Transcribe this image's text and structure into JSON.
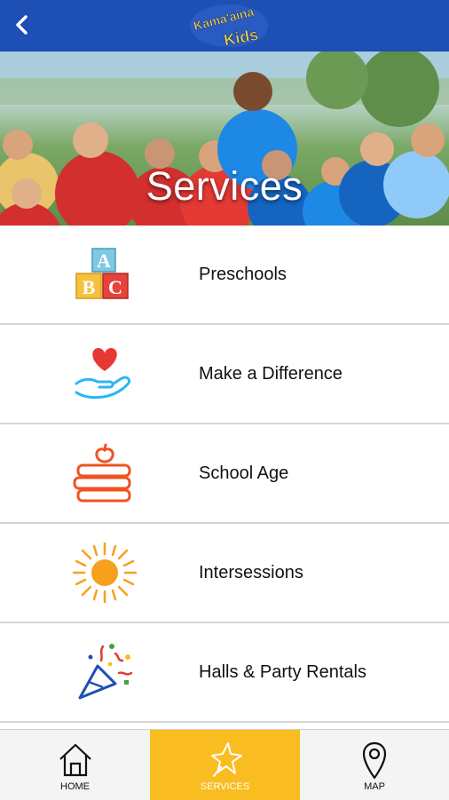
{
  "header": {
    "back_icon": "chevron-left-icon",
    "logo_text_line1": "Kama'aina",
    "logo_text_line2": "Kids",
    "brand_color": "#1d4fb4"
  },
  "hero": {
    "title": "Services"
  },
  "services": [
    {
      "label": "Preschools",
      "icon": "abc-blocks-icon"
    },
    {
      "label": "Make a Difference",
      "icon": "heart-hand-icon"
    },
    {
      "label": "School Age",
      "icon": "books-apple-icon"
    },
    {
      "label": "Intersessions",
      "icon": "sun-icon"
    },
    {
      "label": "Halls & Party Rentals",
      "icon": "party-popper-icon"
    }
  ],
  "tabs": [
    {
      "label": "HOME",
      "icon": "home-icon",
      "active": false
    },
    {
      "label": "SERVICES",
      "icon": "star-icon",
      "active": true
    },
    {
      "label": "MAP",
      "icon": "map-pin-icon",
      "active": false
    }
  ],
  "colors": {
    "accent": "#f9bd21",
    "tab_bar": "#f4f4f4"
  }
}
